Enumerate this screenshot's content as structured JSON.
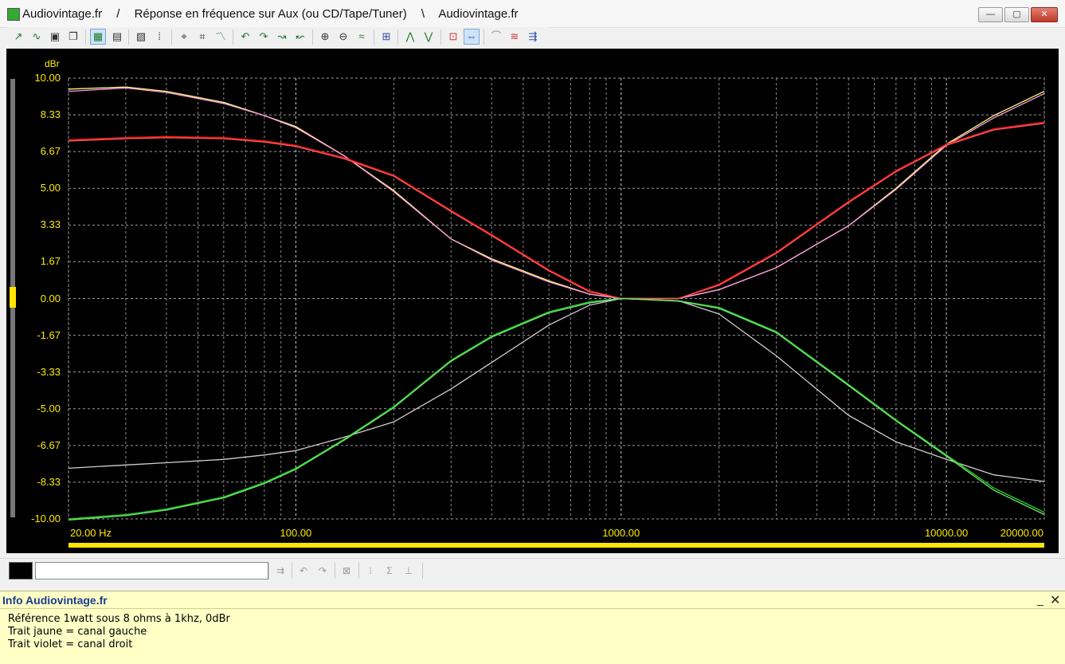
{
  "window": {
    "title_parts": [
      "Audiovintage.fr",
      "/",
      "Réponse en fréquence sur Aux (ou CD/Tape/Tuner)",
      "\\",
      "Audiovintage.fr"
    ],
    "controls": {
      "minimize": "—",
      "maximize": "▢",
      "close": "✕"
    }
  },
  "toolbar": {
    "icons": [
      "curve-add-icon",
      "curve-smooth-icon",
      "save-icon",
      "copy-icon",
      "graph-view-icon",
      "grid-icon",
      "properties-icon",
      "dotted-grid-icon",
      "zoom-x-icon",
      "zoom-y-icon",
      "curve-fit-icon",
      "undo-icon",
      "redo-icon",
      "next-icon",
      "prev-icon",
      "zoom-in-icon",
      "zoom-out-icon",
      "autoscale-icon",
      "cursor-icon",
      "peak-icon",
      "valley-icon",
      "marker-icon",
      "measure-icon",
      "compare-icon",
      "filter-icon",
      "export-icon"
    ]
  },
  "chart_data": {
    "type": "line",
    "title": "",
    "xlabel": "",
    "ylabel": "dBr",
    "x_scale": "log",
    "xlim": [
      20,
      20000
    ],
    "ylim": [
      -10,
      10
    ],
    "y_ticks": [
      "10.00",
      "8.33",
      "6.67",
      "5.00",
      "3.33",
      "1.67",
      "0.00",
      "-1.67",
      "-3.33",
      "-5.00",
      "-6.67",
      "-8.33",
      "-10.00"
    ],
    "x_tick_labels": [
      {
        "x": 20,
        "label": "20.00 Hz"
      },
      {
        "x": 100,
        "label": "100.00"
      },
      {
        "x": 1000,
        "label": "1000.00"
      },
      {
        "x": 10000,
        "label": "10000.00"
      },
      {
        "x": 20000,
        "label": "20000.00"
      }
    ],
    "grid": true,
    "series": [
      {
        "color": "#ffff7a",
        "x": [
          20,
          30,
          40,
          60,
          80,
          100,
          140,
          200,
          300,
          400,
          600,
          800,
          1000,
          1500,
          2000,
          3000,
          5000,
          7000,
          10000,
          14000,
          20000
        ],
        "y": [
          9.5,
          9.6,
          9.4,
          8.9,
          8.3,
          7.8,
          6.5,
          4.9,
          2.7,
          1.8,
          0.8,
          0.2,
          0.0,
          0.0,
          0.4,
          1.4,
          3.3,
          5.0,
          7.0,
          8.3,
          9.4
        ]
      },
      {
        "color": "#ff9be6",
        "x": [
          20,
          30,
          40,
          60,
          80,
          100,
          140,
          200,
          300,
          400,
          600,
          800,
          1000,
          1500,
          2000,
          3000,
          5000,
          7000,
          10000,
          14000,
          20000
        ],
        "y": [
          9.4,
          9.55,
          9.35,
          8.85,
          8.3,
          7.75,
          6.5,
          4.85,
          2.7,
          1.75,
          0.75,
          0.2,
          0.0,
          0.0,
          0.4,
          1.4,
          3.3,
          4.95,
          6.95,
          8.2,
          9.3
        ]
      },
      {
        "color": "#ff1a1a",
        "x": [
          20,
          30,
          40,
          60,
          80,
          100,
          140,
          200,
          300,
          400,
          600,
          800,
          1000,
          1500,
          2000,
          3000,
          5000,
          7000,
          10000,
          14000,
          20000
        ],
        "y": [
          7.2,
          7.3,
          7.35,
          7.3,
          7.15,
          6.95,
          6.4,
          5.6,
          4.0,
          2.9,
          1.3,
          0.35,
          0.0,
          0.0,
          0.65,
          2.1,
          4.4,
          5.8,
          7.0,
          7.7,
          8.0
        ]
      },
      {
        "color": "#ff5a5a",
        "x": [
          20,
          30,
          40,
          60,
          80,
          100,
          140,
          200,
          300,
          400,
          600,
          800,
          1000,
          1500,
          2000,
          3000,
          5000,
          7000,
          10000,
          14000,
          20000
        ],
        "y": [
          7.15,
          7.25,
          7.3,
          7.25,
          7.1,
          6.9,
          6.35,
          5.55,
          3.95,
          2.85,
          1.25,
          0.3,
          0.0,
          0.0,
          0.6,
          2.05,
          4.35,
          5.75,
          6.95,
          7.65,
          7.95
        ]
      },
      {
        "color": "#cfcfcf",
        "x": [
          20,
          30,
          40,
          60,
          80,
          100,
          140,
          200,
          300,
          400,
          600,
          800,
          1000,
          1500,
          2000,
          3000,
          5000,
          7000,
          10000,
          14000,
          20000
        ],
        "y": [
          -7.7,
          -7.55,
          -7.45,
          -7.3,
          -7.1,
          -6.9,
          -6.3,
          -5.6,
          -4.1,
          -2.9,
          -1.2,
          -0.3,
          0.0,
          -0.1,
          -0.7,
          -2.6,
          -5.3,
          -6.5,
          -7.3,
          -8.0,
          -8.3
        ]
      },
      {
        "color": "#22dd22",
        "x": [
          20,
          30,
          40,
          60,
          80,
          100,
          140,
          200,
          300,
          400,
          600,
          800,
          1000,
          1500,
          2000,
          3000,
          5000,
          7000,
          10000,
          14000,
          20000
        ],
        "y": [
          -10.0,
          -9.8,
          -9.55,
          -9.0,
          -8.35,
          -7.7,
          -6.4,
          -4.9,
          -2.8,
          -1.7,
          -0.6,
          -0.15,
          0.0,
          -0.1,
          -0.4,
          -1.5,
          -3.9,
          -5.5,
          -7.1,
          -8.6,
          -9.7
        ]
      },
      {
        "color": "#7ae07a",
        "x": [
          20,
          30,
          40,
          60,
          80,
          100,
          140,
          200,
          300,
          400,
          600,
          800,
          1000,
          1500,
          2000,
          3000,
          5000,
          7000,
          10000,
          14000,
          20000
        ],
        "y": [
          -10.05,
          -9.85,
          -9.6,
          -9.05,
          -8.4,
          -7.75,
          -6.45,
          -4.95,
          -2.85,
          -1.75,
          -0.65,
          -0.2,
          0.0,
          -0.12,
          -0.45,
          -1.55,
          -3.95,
          -5.55,
          -7.15,
          -8.7,
          -9.8
        ]
      }
    ]
  },
  "statusbar": {
    "input_value": "",
    "icons": [
      "axis-icon",
      "undo-icon",
      "redo-icon",
      "scale-icon",
      "stats-icon",
      "sum-icon",
      "chart-icon"
    ]
  },
  "info": {
    "title": "Info Audiovintage.fr",
    "minimize": "_",
    "close": "✕",
    "lines": [
      "Référence 1watt sous 8 ohms à 1khz, 0dBr",
      "Trait jaune = canal gauche",
      "Trait violet = canal droit"
    ]
  }
}
